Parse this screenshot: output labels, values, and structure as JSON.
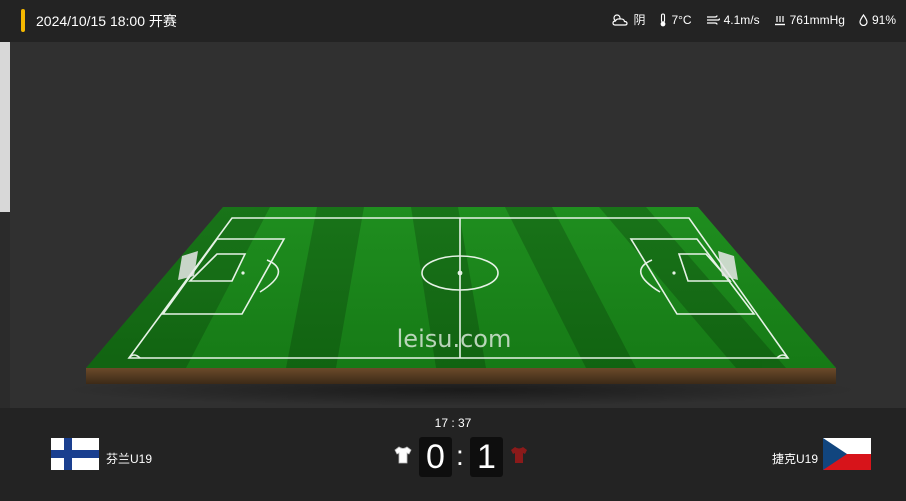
{
  "header": {
    "datetime": "2024/10/15 18:00 开赛"
  },
  "weather": {
    "condition": "阴",
    "temperature": "7°C",
    "wind": "4.1m/s",
    "pressure": "761mmHg",
    "humidity": "91%"
  },
  "pitch": {
    "watermark": "leisu.com"
  },
  "match": {
    "clock": "17 : 37",
    "home_team": "芬兰U19",
    "away_team": "捷克U19",
    "home_score": "0",
    "away_score": "1",
    "score_separator": ":"
  },
  "colors": {
    "accent": "#f5b800",
    "home_shirt": "#ffffff",
    "away_shirt": "#8b1a1a"
  }
}
